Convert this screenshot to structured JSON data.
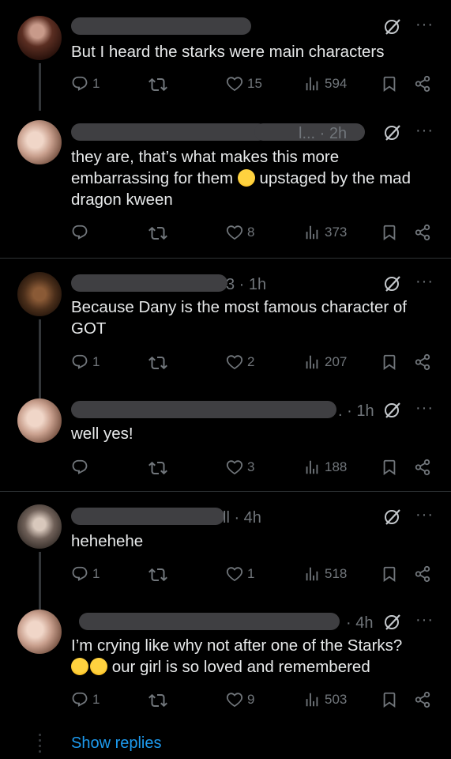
{
  "colors": {
    "background": "#000000",
    "text": "#e7e9ea",
    "muted": "#71767b",
    "link": "#1d9bf0",
    "redaction": "#3f3f42"
  },
  "tweets": [
    {
      "time": "",
      "text": "But I heard the starks were main characters",
      "replies": "1",
      "retweets": "",
      "likes": "15",
      "views": "594"
    },
    {
      "time": "l... · 2h",
      "text_before_emoji": "they are, that’s what makes this more embarrassing for them",
      "text_after_emoji": "upstaged by the mad dragon kween",
      "emoji": "face-with-hand-over-mouth",
      "replies": "",
      "retweets": "",
      "likes": "8",
      "views": "373"
    },
    {
      "time": "3 · 1h",
      "text": "Because Dany is the most famous character of GOT",
      "replies": "1",
      "retweets": "",
      "likes": "2",
      "views": "207"
    },
    {
      "time": ". · 1h",
      "text": "well yes!",
      "replies": "",
      "retweets": "",
      "likes": "3",
      "views": "188"
    },
    {
      "time": "ll · 4h",
      "text": "hehehehe",
      "replies": "1",
      "retweets": "",
      "likes": "1",
      "views": "518"
    },
    {
      "time": "· 4h",
      "text_line1": "I’m crying like why not after one of the Starks?",
      "text_line2": "our girl is so loved and remembered",
      "emoji": "loudly-crying-face",
      "replies": "1",
      "retweets": "",
      "likes": "9",
      "views": "503"
    }
  ],
  "show_replies": "Show replies",
  "icons": [
    "reply-icon",
    "retweet-icon",
    "like-icon",
    "views-icon",
    "bookmark-icon",
    "share-icon",
    "grok-icon",
    "more-icon"
  ]
}
